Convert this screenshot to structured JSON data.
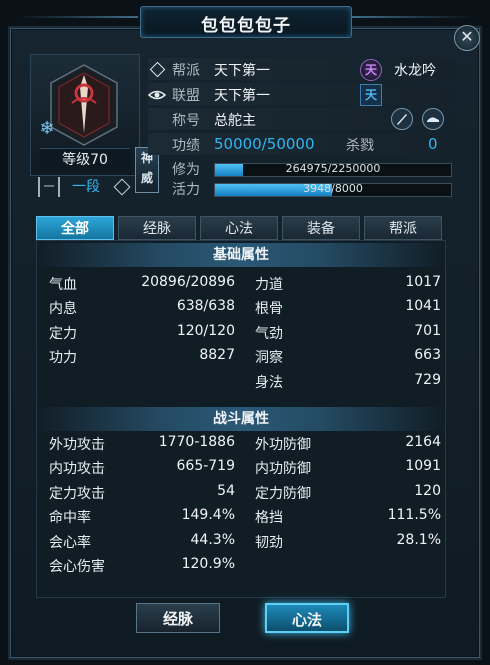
{
  "window": {
    "title": "包包包包子"
  },
  "portrait": {
    "emblem_label": "神威",
    "level": "等级70",
    "rank_badge": "一段",
    "rank_text": "一段"
  },
  "info": {
    "sect_label": "帮派",
    "sect_value": "天下第一",
    "alliance_label": "联盟",
    "alliance_value": "天下第一",
    "server_badge": "天",
    "server_name": "水龙吟",
    "alliance_badge": "天",
    "title_label": "称号",
    "title_value": "总舵主",
    "merit_label": "功绩",
    "merit_value": "50000/50000",
    "kill_label": "杀戮",
    "kill_value": "0",
    "cultivation_label": "修为",
    "cultivation_value": "264975/2250000",
    "cultivation_ratio": 0.118,
    "vitality_label": "活力",
    "vitality_value": "3948/8000",
    "vitality_ratio": 0.494
  },
  "tabs": [
    "全部",
    "经脉",
    "心法",
    "装备",
    "帮派"
  ],
  "basic": {
    "title": "基础属性",
    "left": [
      {
        "k": "气血",
        "v": "20896/20896"
      },
      {
        "k": "内息",
        "v": "638/638"
      },
      {
        "k": "定力",
        "v": "120/120"
      },
      {
        "k": "功力",
        "v": "8827"
      }
    ],
    "right": [
      {
        "k": "力道",
        "v": "1017"
      },
      {
        "k": "根骨",
        "v": "1041"
      },
      {
        "k": "气劲",
        "v": "701"
      },
      {
        "k": "洞察",
        "v": "663"
      },
      {
        "k": "身法",
        "v": "729"
      }
    ]
  },
  "combat": {
    "title": "战斗属性",
    "left": [
      {
        "k": "外功攻击",
        "v": "1770-1886"
      },
      {
        "k": "内功攻击",
        "v": "665-719"
      },
      {
        "k": "定力攻击",
        "v": "54"
      },
      {
        "k": "命中率",
        "v": "149.4%"
      },
      {
        "k": "会心率",
        "v": "44.3%"
      },
      {
        "k": "会心伤害",
        "v": "120.9%"
      }
    ],
    "right": [
      {
        "k": "外功防御",
        "v": "2164"
      },
      {
        "k": "内功防御",
        "v": "1091"
      },
      {
        "k": "定力防御",
        "v": "120"
      },
      {
        "k": "格挡",
        "v": "111.5%"
      },
      {
        "k": "韧劲",
        "v": "28.1%"
      }
    ]
  },
  "buttons": {
    "meridian": "经脉",
    "heart_method": "心法"
  },
  "colors": {
    "accent": "#2fb6f0",
    "active_tab": "#1f8fc0"
  }
}
